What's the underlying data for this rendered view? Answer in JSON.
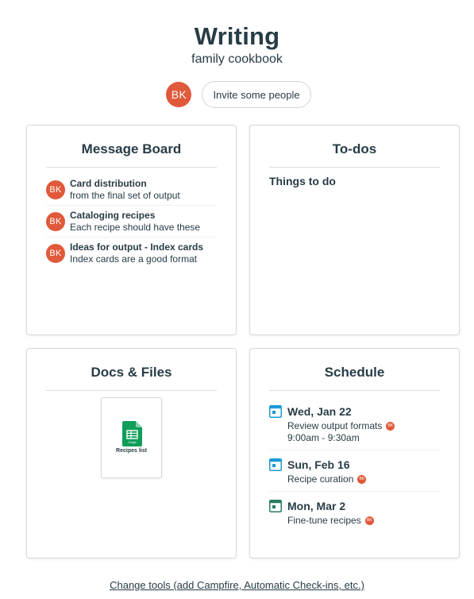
{
  "project": {
    "name": "Writing",
    "description": "family cookbook"
  },
  "people": {
    "avatar_initials": "BK",
    "invite_label": "Invite some people"
  },
  "colors": {
    "text": "#283c46",
    "avatar_bg": "#e0593a",
    "calendar_blue": "#1b9ad6",
    "calendar_green": "#2a7d5f",
    "sheets_green": "#0f9d58"
  },
  "message_board": {
    "title": "Message Board",
    "messages": [
      {
        "author": "BK",
        "title": "Card distribution",
        "excerpt": "from the final set of output"
      },
      {
        "author": "BK",
        "title": "Cataloging recipes",
        "excerpt": "Each recipe should have these"
      },
      {
        "author": "BK",
        "title": "Ideas for output - Index cards",
        "excerpt": "Index cards are a good format"
      }
    ]
  },
  "todos": {
    "title": "To-dos",
    "lists": [
      {
        "name": "Things to do"
      }
    ]
  },
  "docs": {
    "title": "Docs & Files",
    "files": [
      {
        "icon": "google-sheets-icon",
        "icon_label": "Google",
        "name": "Recipes list"
      }
    ]
  },
  "schedule": {
    "title": "Schedule",
    "events": [
      {
        "date": "Wed, Jan 22",
        "title": "Review output formats",
        "time": "9:00am - 9:30am",
        "attendee": "BK",
        "icon": "calendar-blue-icon"
      },
      {
        "date": "Sun, Feb 16",
        "title": "Recipe curation",
        "time": "",
        "attendee": "BK",
        "icon": "calendar-blue-icon"
      },
      {
        "date": "Mon, Mar 2",
        "title": "Fine-tune recipes",
        "time": "",
        "attendee": "BK",
        "icon": "calendar-green-icon"
      }
    ]
  },
  "footer": {
    "change_tools_label": "Change tools (add Campfire, Automatic Check-ins, etc.)"
  }
}
